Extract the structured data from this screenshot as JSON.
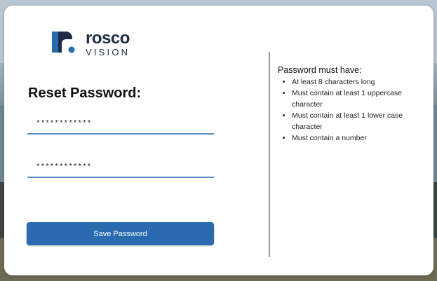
{
  "brand": {
    "name": "rosco",
    "sub": "VISION",
    "colors": {
      "logo_dark": "#1f2a44",
      "logo_blue": "#2a6bb0"
    }
  },
  "form": {
    "title": "Reset Password:",
    "password_field_1": "************",
    "password_field_2": "************",
    "save_label": "Save Password"
  },
  "requirements": {
    "heading": "Password must have:",
    "items": [
      "At least 8 characters long",
      "Must contain at least 1 uppercase character",
      "Must contain at least 1 lower case character",
      "Must contain a number"
    ]
  },
  "colors": {
    "accent": "#2a6bb0",
    "underline": "#5b8fc3"
  }
}
